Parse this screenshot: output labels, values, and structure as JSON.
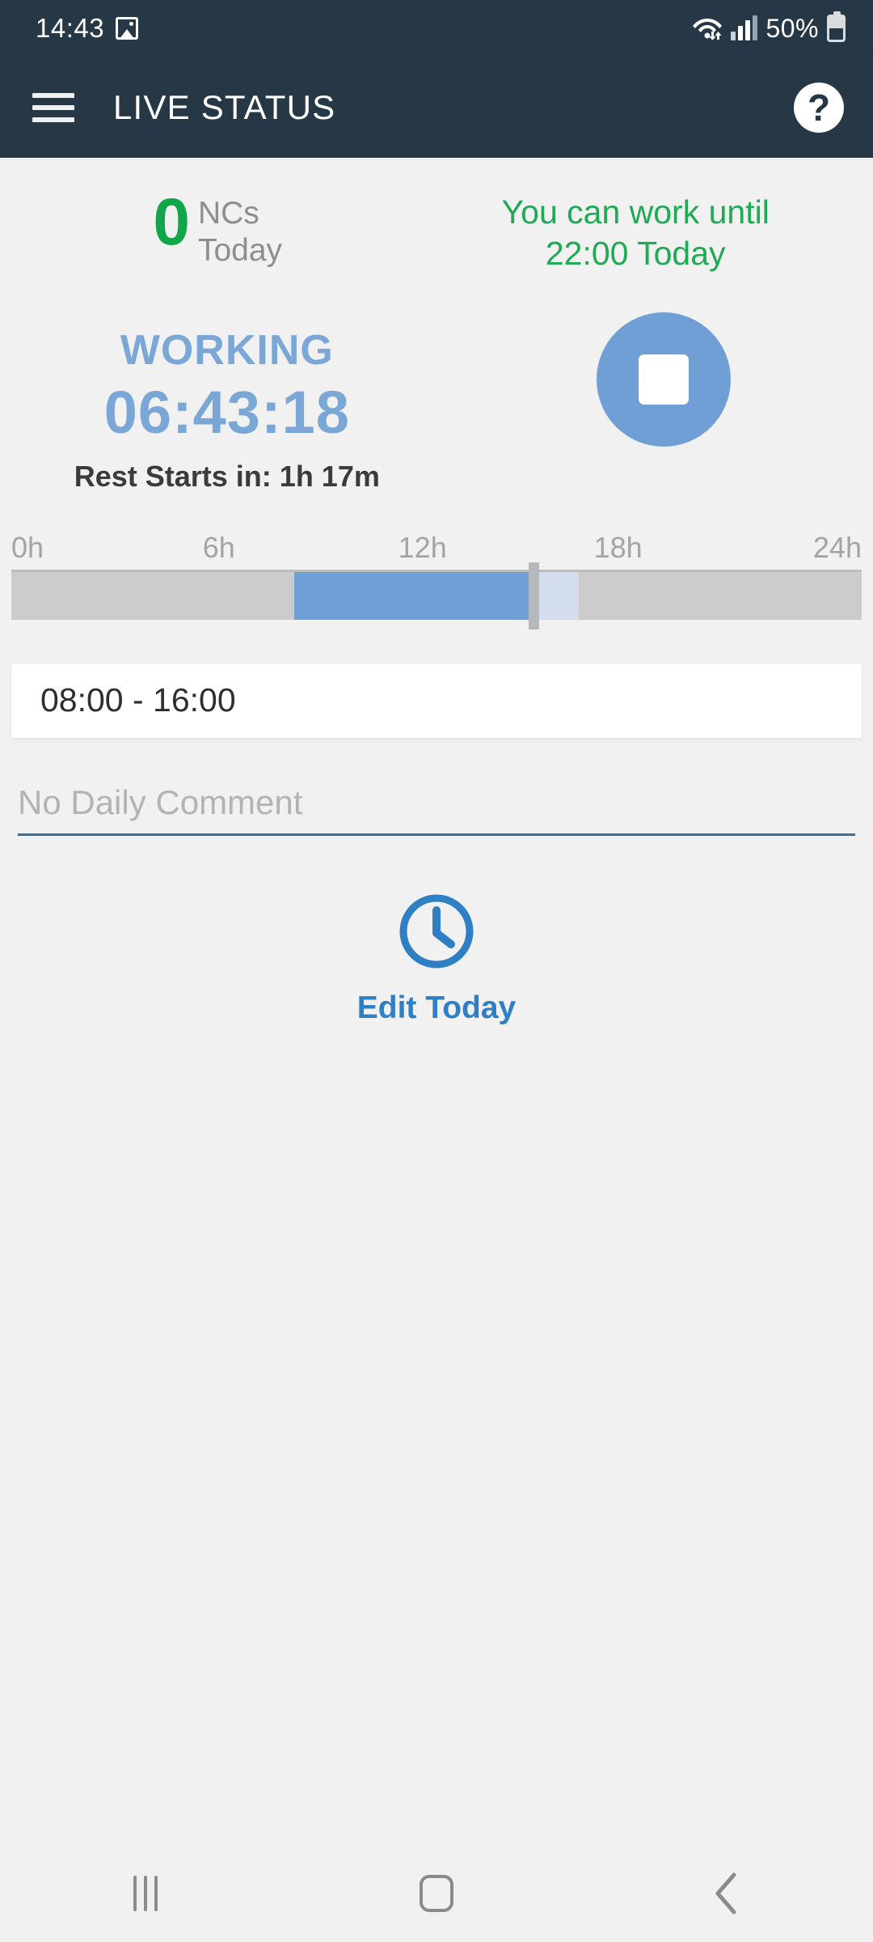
{
  "status_bar": {
    "time": "14:43",
    "battery_percent": "50%",
    "icons": [
      "gallery-icon",
      "wifi-icon",
      "signal-icon",
      "battery-icon"
    ]
  },
  "app_bar": {
    "menu_icon": "hamburger-menu-icon",
    "title": "LIVE STATUS",
    "help_icon": "question-mark-icon"
  },
  "summary": {
    "nc_count": "0",
    "nc_label_line1": "NCs",
    "nc_label_line2": "Today",
    "work_until_line1": "You can work until",
    "work_until_line2": "22:00 Today",
    "nc_color": "#11a64a",
    "work_until_color": "#1faa53"
  },
  "live_status": {
    "state": "WORKING",
    "timer": "06:43:18",
    "rest_notice": "Rest Starts in: 1h 17m",
    "accent_color": "#7ba7d7",
    "stop_button_icon": "stop-square-icon"
  },
  "timeline": {
    "tick_labels": [
      "0h",
      "6h",
      "12h",
      "18h",
      "24h"
    ],
    "tick_positions_pct": [
      0,
      25,
      50,
      75,
      100
    ],
    "active_start_pct": 33.3,
    "active_end_pct": 61.2,
    "planned_end_pct": 66.7,
    "marker_pct": 61.2,
    "track_color": "#cccccc",
    "active_color": "#6f9fd4",
    "planned_color": "#d3ddeb"
  },
  "schedule": {
    "shift_range": "08:00 - 16:00"
  },
  "comment": {
    "value": "",
    "placeholder": "No Daily Comment"
  },
  "edit_today": {
    "icon": "clock-icon",
    "label": "Edit Today",
    "color": "#2f7fc4"
  },
  "nav_bar": {
    "recents_label": "recents-icon",
    "home_label": "home-icon",
    "back_label": "back-icon"
  }
}
